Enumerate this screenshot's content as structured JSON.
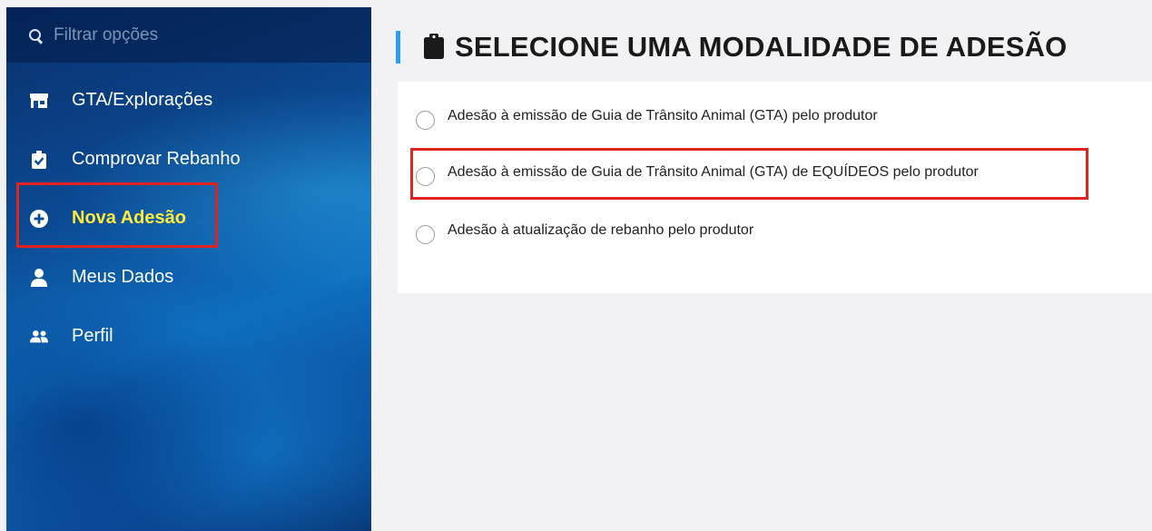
{
  "search": {
    "placeholder": "Filtrar opções"
  },
  "sidebar": {
    "items": [
      {
        "label": "GTA/Explorações",
        "icon": "store-icon"
      },
      {
        "label": "Comprovar Rebanho",
        "icon": "clipboard-check-icon"
      },
      {
        "label": "Nova Adesão",
        "icon": "plus-circle-icon",
        "active": true
      },
      {
        "label": "Meus Dados",
        "icon": "user-icon"
      },
      {
        "label": "Perfil",
        "icon": "users-icon"
      }
    ],
    "active_color": "#ffeb3b"
  },
  "main": {
    "title": "SELECIONE UMA MODALIDADE DE ADESÃO",
    "title_icon": "clipboard-icon",
    "accent_color": "#2a9df4",
    "options": [
      {
        "label": "Adesão à emissão de Guia de Trânsito Animal (GTA) pelo produtor",
        "selected": false
      },
      {
        "label": "Adesão à emissão de Guia de Trânsito Animal (GTA) de EQUÍDEOS pelo produtor",
        "selected": false,
        "highlighted": true
      },
      {
        "label": "Adesão à atualização de rebanho pelo produtor",
        "selected": false
      }
    ]
  },
  "highlight_color": "#e0231f"
}
